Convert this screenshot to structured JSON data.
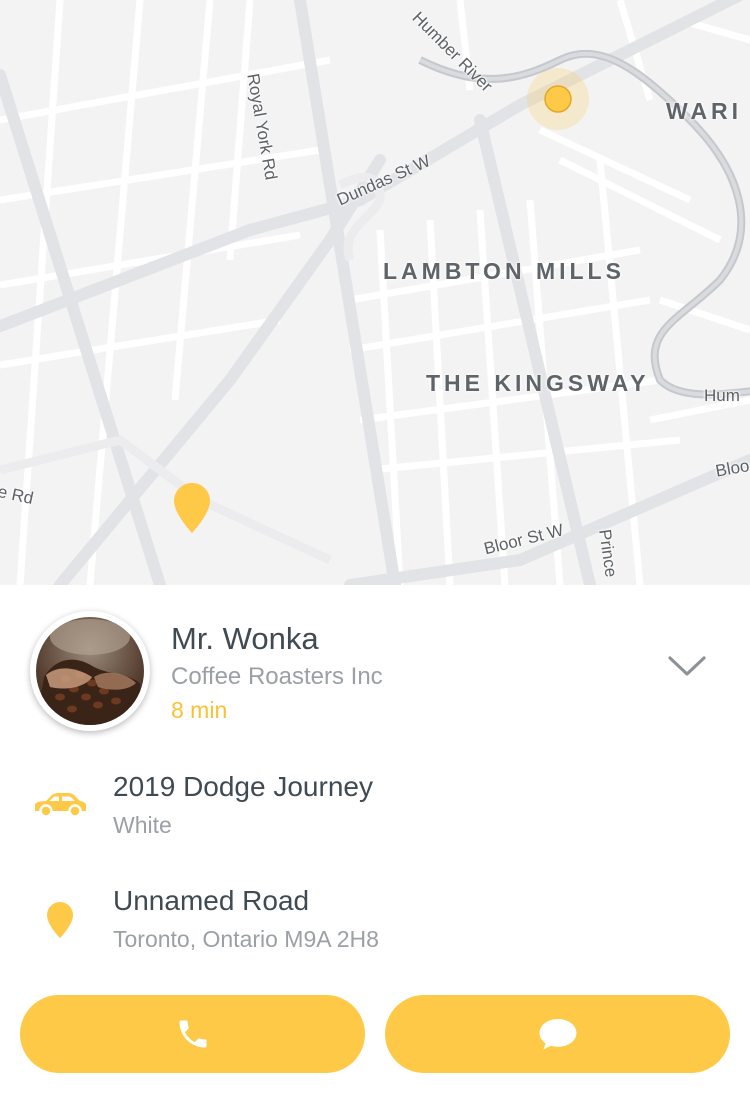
{
  "map": {
    "street_labels": {
      "royal_york": "Royal York Rd",
      "humber_river_top": "Humber River",
      "humber_river_right": "Hum",
      "dundas": "Dundas St W",
      "bloor": "Bloor St W",
      "bloor_right": "Bloo",
      "prince": "Prince",
      "rd_left": "e Rd"
    },
    "district_labels": {
      "lambton_mills": "LAMBTON MILLS",
      "kingsway": "THE KINGSWAY",
      "ward": "WARI"
    },
    "accent_color": "#fec946"
  },
  "driver": {
    "name": "Mr. Wonka",
    "company": "Coffee Roasters Inc",
    "eta": "8 min",
    "avatar_icon": "coffee-beans-photo"
  },
  "vehicle": {
    "model": "2019 Dodge Journey",
    "color": "White",
    "icon": "car-icon"
  },
  "location": {
    "street": "Unnamed Road",
    "city_line": "Toronto, Ontario M9A 2H8",
    "icon": "location-pin-icon"
  },
  "actions": {
    "call_icon": "phone-icon",
    "message_icon": "chat-bubble-icon",
    "button_color": "#fec946"
  },
  "colors": {
    "accent": "#f8c234",
    "text_primary": "#3f4a52",
    "text_secondary": "#9aa0a5"
  }
}
